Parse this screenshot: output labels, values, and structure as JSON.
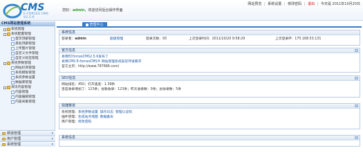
{
  "header": {
    "logo_main": "CMS",
    "logo_sub": "E-FORCES CMS V2.5.6",
    "welcome_prefix": "您好：",
    "user": "admin",
    "welcome_suffix": "，欢迎访问后台操作界面",
    "nav": [
      "网站预览",
      "系统设置",
      "修改密码",
      "退出"
    ],
    "date": "今天是 2011年10月20日"
  },
  "sidebar": {
    "title": "CMS网站管理系统",
    "tree": [
      {
        "label": "系统管理",
        "level": 1
      },
      {
        "label": "系统配置管理",
        "level": 1
      },
      {
        "label": "首页顶部管理",
        "level": 2
      },
      {
        "label": "其他顶部管理",
        "level": 2
      },
      {
        "label": "上传图片管理",
        "level": 2
      },
      {
        "label": "自定义文件管理",
        "level": 2
      },
      {
        "label": "自定义标签管理",
        "level": 2
      },
      {
        "label": "系统参数管理",
        "level": 1
      },
      {
        "label": "网站栏目管理",
        "level": 2
      },
      {
        "label": "系统模板管理",
        "level": 2
      },
      {
        "label": "系统参数设置",
        "level": 2
      },
      {
        "label": "数据库管理",
        "level": 2
      },
      {
        "label": "资讯内容管理",
        "level": 1
      },
      {
        "label": "内容管理",
        "level": 2
      },
      {
        "label": "内容编辑管理",
        "level": 2
      },
      {
        "label": "内容采集管理",
        "level": 2
      }
    ],
    "bottom": [
      "频道管理",
      "用户管理",
      "系统管理"
    ]
  },
  "main": {
    "tab": "管理中心",
    "panels": {
      "login": {
        "title": "系统信息",
        "user_label": "登录者：",
        "user": "admin",
        "role": "超级管理",
        "count_label": "登录次数：",
        "count": "93",
        "last_time_label": "上次登录时间：",
        "last_time": "2011/10/20 9:58:29",
        "last_ip_label": "上次登录IP：",
        "last_ip": "175.168.53.131"
      },
      "official": {
        "title": "官方信息",
        "lines": [
          "易用ECforcesCMS2.5.6发布了",
          "易用CMS E-forcesCMS® 网站管理系统安装环境要求",
          "官方主页：http://www.787666.com/"
        ]
      },
      "seo": {
        "title": "SEO信息",
        "line1": "网站排名：450；打开速度：1.39秒",
        "line2": "百度收录增加了：123条；谷歌收录：123条；昨天收录数：0条；总收录数：5条"
      },
      "shortcut": {
        "title": "快捷菜单",
        "rows": [
          {
            "label": "系统管理：",
            "links": [
              "系统参数设置",
              "操作日志",
              "管理认证码"
            ]
          },
          {
            "label": "插件管理：",
            "links": [
              "生成站点地图",
              "数据备份"
            ]
          },
          {
            "label": "用户管理：",
            "links": [
              "修改密码"
            ]
          }
        ]
      },
      "sysinfo": {
        "title": "系统信息"
      }
    }
  }
}
